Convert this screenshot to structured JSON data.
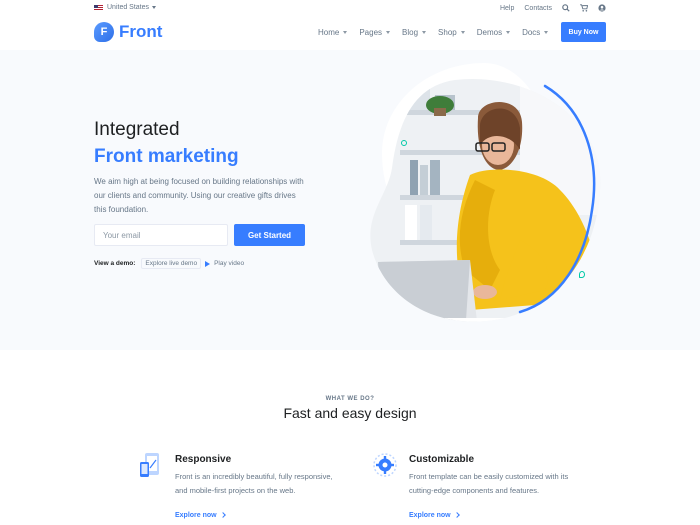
{
  "topbar": {
    "language": "United States",
    "links": [
      "Help",
      "Contacts"
    ],
    "icons": [
      "search-icon",
      "cart-icon",
      "account-icon"
    ]
  },
  "nav": {
    "logo_letter": "F",
    "logo_text": "Front",
    "menu": [
      "Home",
      "Pages",
      "Blog",
      "Shop",
      "Demos",
      "Docs"
    ],
    "buy_label": "Buy Now"
  },
  "hero": {
    "title_line1": "Integrated",
    "title_line2": "Front marketing",
    "lead": "We aim high at being focused on building relationships with our clients and community. Using our creative gifts drives this foundation.",
    "email_placeholder": "Your email",
    "cta_label": "Get Started",
    "demo_label": "View a demo:",
    "demo_link": "Explore live demo",
    "video_link": "Play video"
  },
  "section": {
    "eyebrow": "WHAT WE DO?",
    "title": "Fast and easy design",
    "features": [
      {
        "title": "Responsive",
        "desc": "Front is an incredibly beautiful, fully responsive, and mobile-first projects on the web.",
        "link": "Explore now",
        "icon": "devices-icon"
      },
      {
        "title": "Customizable",
        "desc": "Front template can be easily customized with its cutting-edge components and features.",
        "link": "Explore now",
        "icon": "settings-gear-icon"
      }
    ]
  },
  "colors": {
    "primary": "#377dff",
    "accent": "#00c9a7",
    "text": "#1e2022",
    "muted": "#677788"
  }
}
